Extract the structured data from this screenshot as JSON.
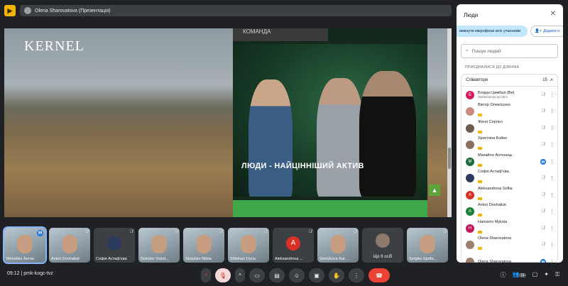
{
  "topbar": {
    "presenter_label": "Olena Sharovatova (Презентація)"
  },
  "slide": {
    "logo_text": "KERNEL",
    "top_strip_text": "КОМАНДА",
    "caption": "ЛЮДИ - НАЙЦІННІШИЙ АКТИВ"
  },
  "tiles": [
    {
      "name": "Miroshko Антон",
      "kind": "video",
      "speaking": true
    },
    {
      "name": "Anton Dovhaliuk",
      "kind": "video",
      "muted": true
    },
    {
      "name": "Софія Астафʼєва",
      "kind": "avatar",
      "initial": "",
      "color": "#2a3a5c",
      "muted": true
    },
    {
      "name": "Sokolov Volod...",
      "kind": "video",
      "muted": true
    },
    {
      "name": "Strashev Nikita",
      "kind": "video",
      "muted": true
    },
    {
      "name": "Shleinan Dyna",
      "kind": "video",
      "muted": true
    },
    {
      "name": "Aleksandrova ...",
      "kind": "avatar",
      "initial": "A",
      "color": "#d93025",
      "muted": true
    },
    {
      "name": "Semykova Kat...",
      "kind": "video",
      "muted": true
    },
    {
      "name": "Ще 6 осіб",
      "kind": "more"
    },
    {
      "name": "Sergiev Щейа...",
      "kind": "video",
      "muted": true
    }
  ],
  "bottombar": {
    "time": "09:12",
    "separator": "|",
    "meeting_code": "pmk-kogc-tvz",
    "participants_count": "11"
  },
  "panel": {
    "title": "Люди",
    "mute_all_label": "имкнути мікрофони всіх учасників",
    "add_people_label": "Додати л",
    "search_placeholder": "Пошук людей",
    "section_label": "ПРИЄДНАЛИСЯ ДО ДЗВІНКА",
    "group_title": "Співавтори",
    "group_count": "15",
    "participants": [
      {
        "name": "Богдан Цимбал (Ви)",
        "sub": "Організатор зустрічі",
        "initial": "Б",
        "color": "#d81b60",
        "mic": "off",
        "hand": false
      },
      {
        "name": "Віктор Олексієнко",
        "sub": "",
        "initial": "",
        "color": "#c98b7b",
        "mic": "off",
        "hand": true
      },
      {
        "name": "Женя Сергієн",
        "sub": "",
        "initial": "",
        "color": "#6d5c50",
        "mic": "off",
        "hand": true
      },
      {
        "name": "Христина Бойко",
        "sub": "",
        "initial": "",
        "color": "#8a6f61",
        "mic": "off",
        "hand": true
      },
      {
        "name": "Михайло Антонець",
        "sub": "",
        "initial": "M",
        "color": "#1e6b3a",
        "mic": "on",
        "hand": true
      },
      {
        "name": "Софія Астафʼєва",
        "sub": "",
        "initial": "",
        "color": "#2a3a5c",
        "mic": "off",
        "hand": true
      },
      {
        "name": "Aleksandrova Sofiia",
        "sub": "",
        "initial": "A",
        "color": "#d93025",
        "mic": "off",
        "hand": true
      },
      {
        "name": "Anton Dovhaliuk",
        "sub": "",
        "initial": "A",
        "color": "#188038",
        "mic": "off",
        "hand": true
      },
      {
        "name": "Hamarov Mykola",
        "sub": "",
        "initial": "H",
        "color": "#c2185b",
        "mic": "off",
        "hand": true
      },
      {
        "name": "Olena Sharovatova",
        "sub": "",
        "initial": "",
        "color": "#9a7e6e",
        "mic": "off",
        "hand": true
      },
      {
        "name": "Olena Sharovatova",
        "sub": "",
        "initial": "",
        "color": "#9a7e6e",
        "mic": "on",
        "hand": false
      }
    ]
  }
}
